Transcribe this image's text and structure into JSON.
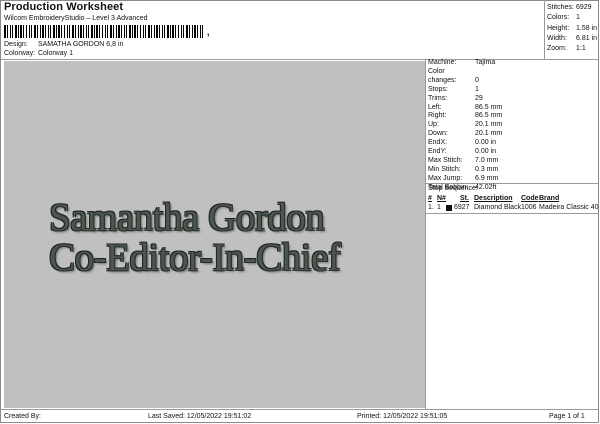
{
  "header": {
    "title": "Production Worksheet",
    "subtitle": "Wilcom EmbroideryStudio – Level 3 Advanced",
    "barcode_suffix": ","
  },
  "meta": {
    "design_label": "Design:",
    "design_value": "SAMATHA GORDON 6,8 in",
    "colorway_label": "Colorway:",
    "colorway_value": "Colorway 1"
  },
  "stats": [
    {
      "label": "Stitches:",
      "value": "6929"
    },
    {
      "label": "Colors:",
      "value": "1"
    },
    {
      "label": "Height:",
      "value": "1.58 in"
    },
    {
      "label": "Width:",
      "value": "6.81 in"
    },
    {
      "label": "Zoom:",
      "value": "1:1"
    }
  ],
  "design": {
    "line1": "Samantha Gordon",
    "line2": "Co-Editor-In-Chief",
    "thread_color": "#4e5650",
    "background": "#c0c0c0"
  },
  "machine_info": [
    {
      "label": "Machine:",
      "value": "Tajima"
    },
    {
      "label": "Color changes:",
      "value": "0"
    },
    {
      "label": "Stops:",
      "value": "1"
    },
    {
      "label": "Trims:",
      "value": "29"
    },
    {
      "label": "Left:",
      "value": "86.5 mm"
    },
    {
      "label": "Right:",
      "value": "86.5 mm"
    },
    {
      "label": "Up:",
      "value": "20.1 mm"
    },
    {
      "label": "Down:",
      "value": "20.1 mm"
    },
    {
      "label": "EndX:",
      "value": "0.00 in"
    },
    {
      "label": "EndY:",
      "value": "0.00 in"
    },
    {
      "label": "Max Stitch:",
      "value": "7.0 mm"
    },
    {
      "label": "Min Stitch:",
      "value": "0.3 mm"
    },
    {
      "label": "Max Jump:",
      "value": "6.9 mm"
    },
    {
      "label": "Total Bobbin:",
      "value": "42.02ft"
    }
  ],
  "stop_sequence": {
    "label": "Stop Sequence:",
    "headers": {
      "num": "#",
      "n": "N#",
      "st": "St.",
      "desc": "Description",
      "code": "Code",
      "brand": "Brand"
    },
    "rows": [
      {
        "num": "1.",
        "n": "1",
        "swatch": "#111111",
        "st": "6927",
        "desc": "Diamond Black",
        "code": "1006",
        "brand": "Madeira Classic 40"
      }
    ]
  },
  "footer": {
    "created_by": "Created By:",
    "last_saved": "Last Saved: 12/05/2022 19:51:02",
    "printed": "Printed: 12/05/2022 19:51:05",
    "page": "Page 1 of 1"
  }
}
